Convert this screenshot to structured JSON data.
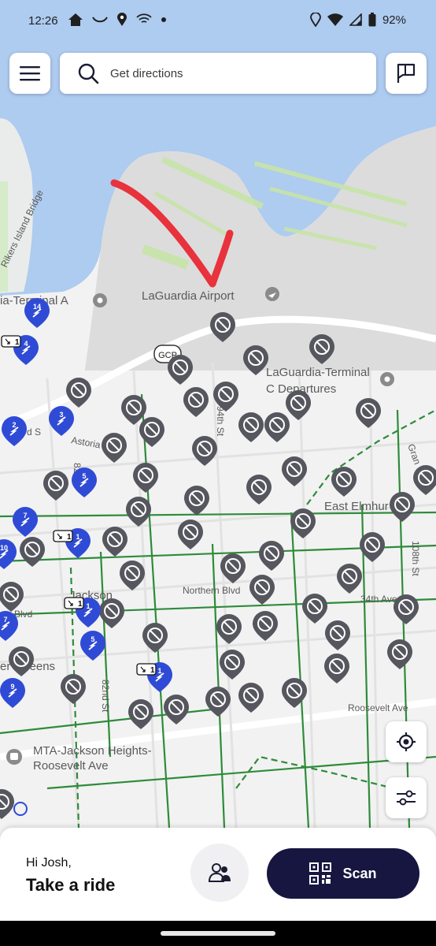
{
  "status_bar": {
    "time": "12:26",
    "battery": "92%"
  },
  "search": {
    "placeholder": "Get directions"
  },
  "map": {
    "labels": {
      "rikers_bridge": "Rikers Island Bridge",
      "terminal_a": "ia-Terminal A",
      "airport": "LaGuardia Airport",
      "terminal_c_1": "LaGuardia-Terminal",
      "terminal_c_2": "C Departures",
      "gcp": "GCP",
      "astoria": "Astoria",
      "astoria_s": "d S",
      "st_94": "94th St",
      "st_82": "82",
      "east_elmhurst": "East Elmhur",
      "grand": "Gran",
      "northern_blvd": "Northern Blvd",
      "jackson": "Jackson",
      "blvd": "Blvd",
      "ave_34": "34th Ave",
      "st_108": "108th St",
      "queens": "er Queens",
      "nd_82": "82nd St",
      "roosevelt": "Roosevelt Ave",
      "mta_1": "MTA-Jackson Heights-",
      "mta_2": "Roosevelt Ave"
    },
    "bike_counts": [
      "14",
      "4",
      "3",
      "2",
      "5",
      "7",
      "1",
      "10",
      "1",
      "5",
      "1",
      "9",
      "7"
    ],
    "zone_badges": [
      "1",
      "1",
      "1",
      "1"
    ],
    "colors": {
      "water": "#aecbf0",
      "land": "#f2f2f2",
      "airport": "#dcdcdc",
      "bike_pin": "#2f4bd6",
      "vehicle_pin": "#55565e",
      "bike_lane": "#2e8b3a",
      "annotation": "#e8323c"
    }
  },
  "bottom": {
    "greeting": "Hi Josh,",
    "cta": "Take a ride",
    "scan_label": "Scan"
  }
}
